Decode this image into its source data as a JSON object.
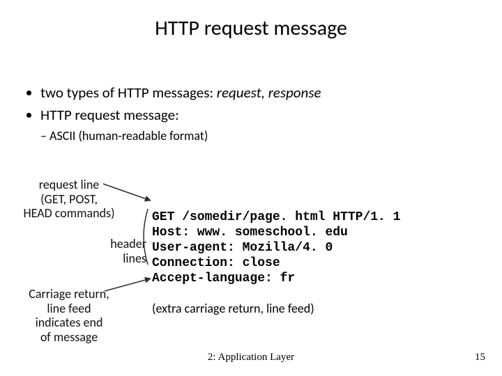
{
  "title": "HTTP request message",
  "bullets": {
    "b1_prefix": "two types of HTTP messages: ",
    "b1_em": "request, response",
    "b2": "HTTP request message:",
    "sub1": "ASCII (human-readable format)"
  },
  "labels": {
    "request_line": "request line\n(GET, POST,\nHEAD commands)",
    "header_lines": "header\nlines",
    "crlf": "Carriage return,\nline feed\nindicates end\nof message"
  },
  "http": {
    "l1": "GET /somedir/page. html HTTP/1. 1",
    "l2": "Host: www. someschool. edu",
    "l3": "User-agent: Mozilla/4. 0",
    "l4": "Connection: close",
    "l5": "Accept-language: fr"
  },
  "extra": "(extra carriage return, line feed)",
  "footer": "2: Application Layer",
  "pagenum": "15"
}
